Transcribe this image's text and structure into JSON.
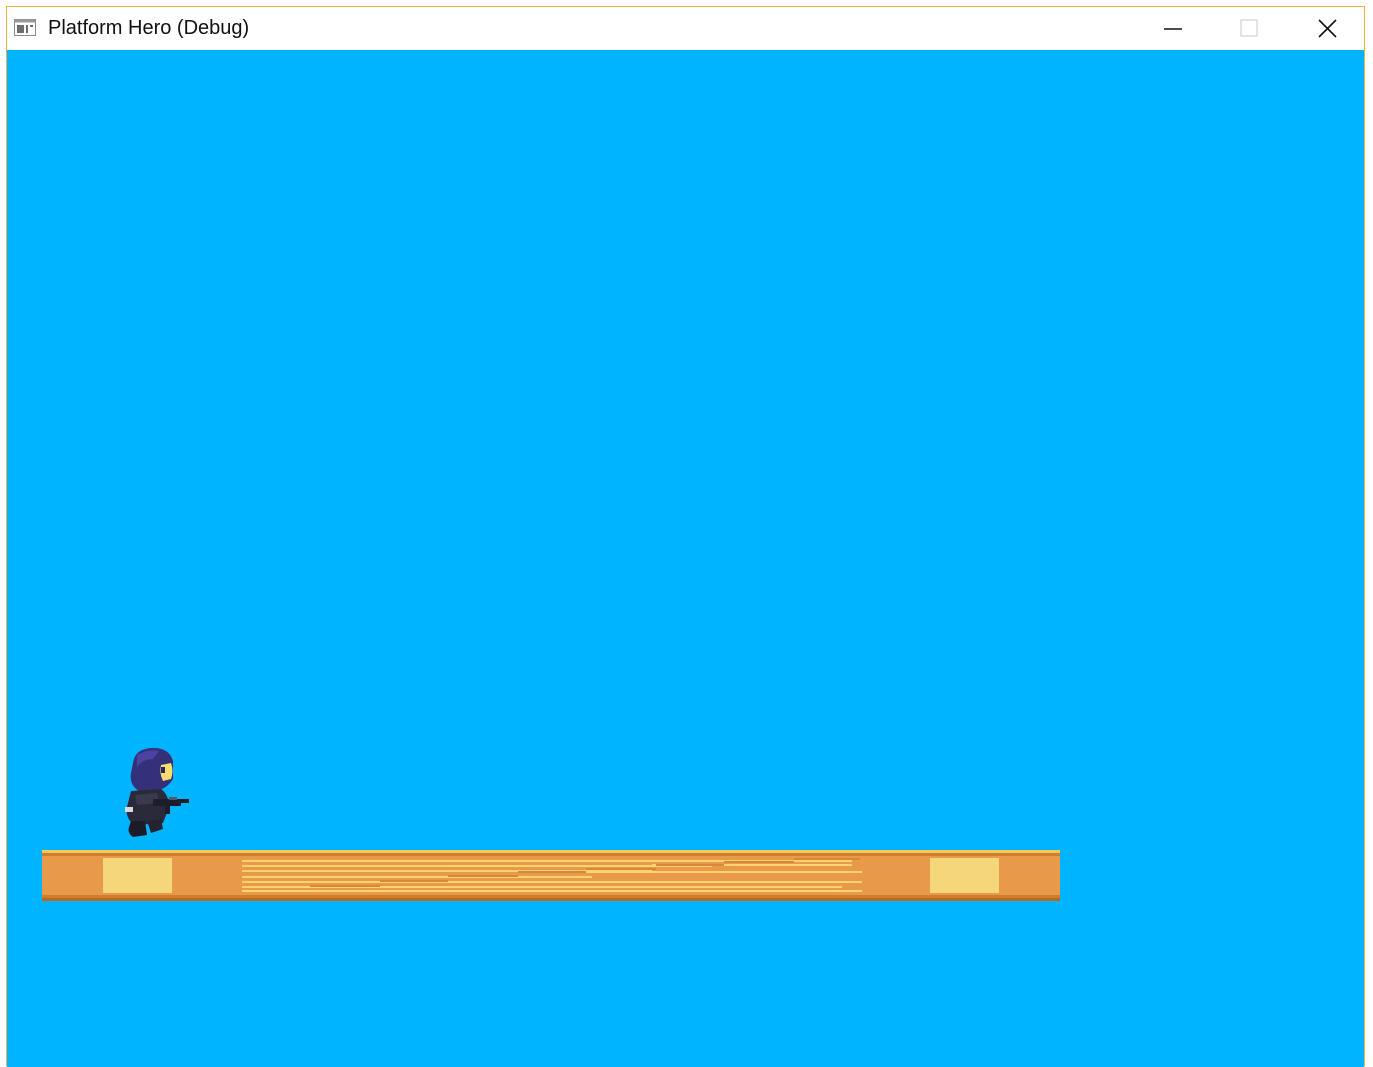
{
  "window": {
    "title": "Platform Hero (Debug)",
    "app_icon": "application-window-icon",
    "controls": {
      "minimize": "minimize-icon",
      "maximize": "maximize-icon",
      "close": "close-icon"
    },
    "border_color": "#f0b13a"
  },
  "game": {
    "background_color": "#00b4ff",
    "player": {
      "sprite": "hooded-hero-with-gun",
      "facing": "right"
    },
    "platform": {
      "colors": {
        "base": "#e8994a",
        "highlight": "#f3d77a",
        "edge": "#d9862e",
        "stripe": "#ffd36b"
      }
    }
  }
}
